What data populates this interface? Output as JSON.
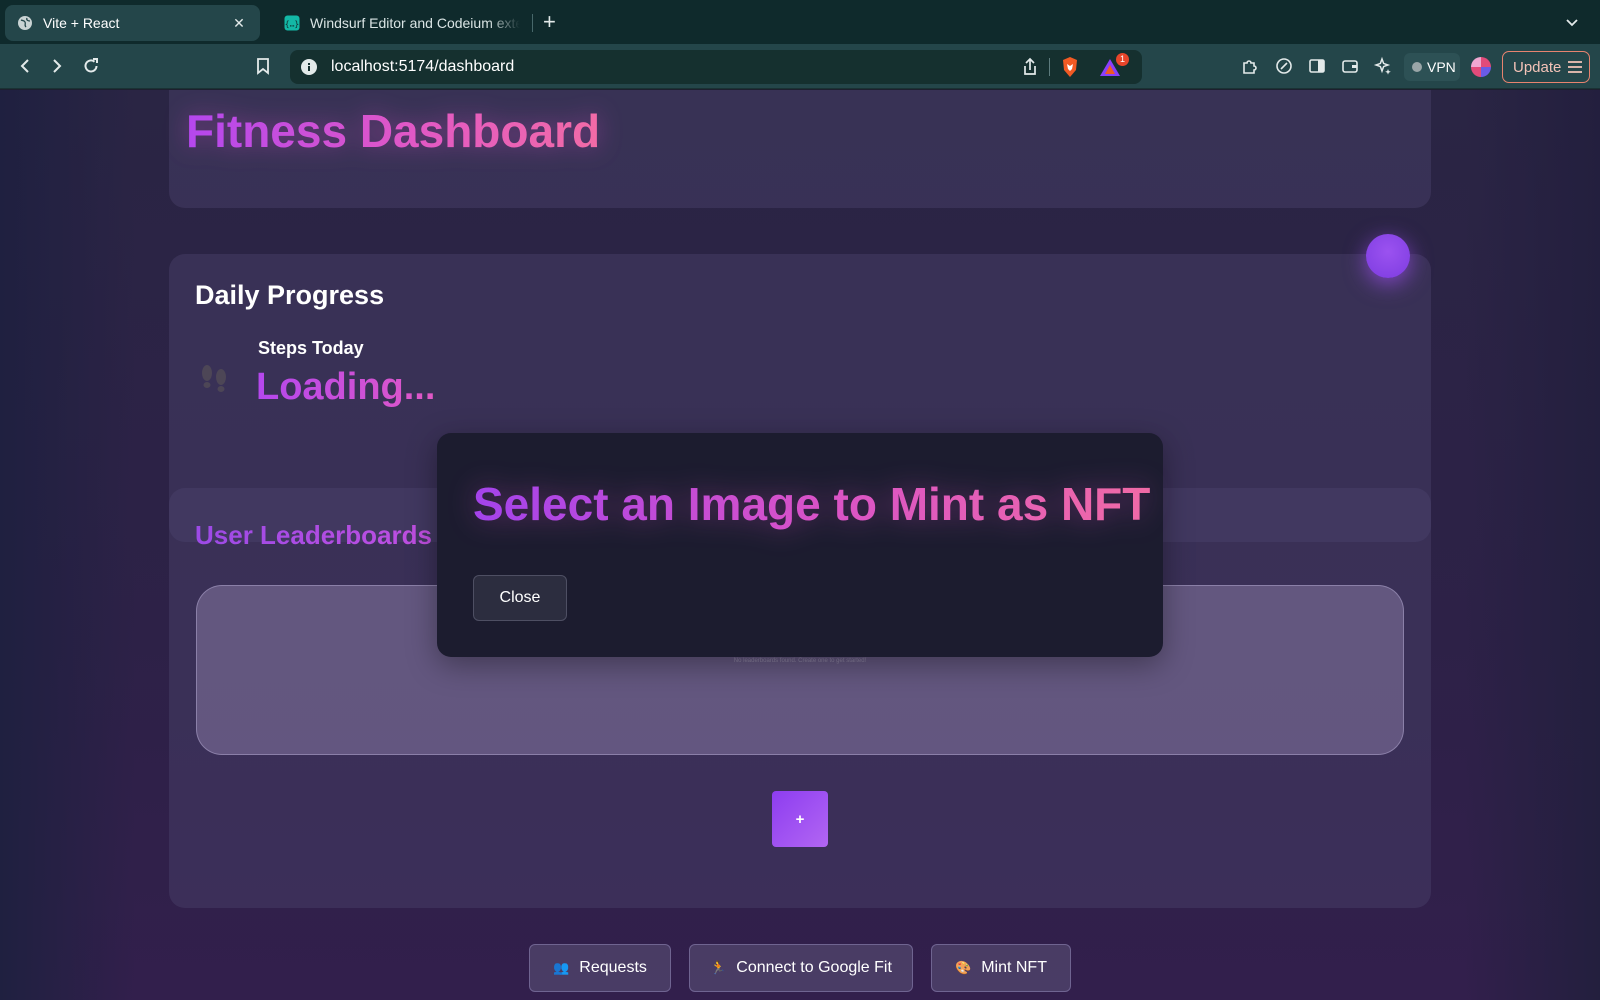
{
  "browser": {
    "tabs": [
      {
        "title": "Vite + React",
        "active": true
      },
      {
        "title": "Windsurf Editor and Codeium extensions",
        "active": false
      }
    ],
    "url": "localhost:5174/dashboard",
    "rewards_badge": "1",
    "vpn_label": "VPN",
    "update_label": "Update"
  },
  "dashboard": {
    "title": "Fitness Dashboard",
    "daily_progress": {
      "heading": "Daily Progress",
      "steps_label": "Steps Today",
      "steps_value": "Loading..."
    },
    "leaderboard": {
      "heading": "User Leaderboards",
      "empty_note": "No leaderboards found. Create one to get started!",
      "add_label": "+"
    },
    "actions": [
      {
        "label": "Requests",
        "icon": "people-icon"
      },
      {
        "label": "Connect to Google Fit",
        "icon": "runner-icon"
      },
      {
        "label": "Mint NFT",
        "icon": "palette-icon"
      }
    ]
  },
  "modal": {
    "title": "Select an Image to Mint as NFT",
    "close_label": "Close"
  },
  "colors": {
    "accent_purple": "#a443eb",
    "accent_pink": "#f06aa6",
    "browser_chrome": "#24464a"
  }
}
